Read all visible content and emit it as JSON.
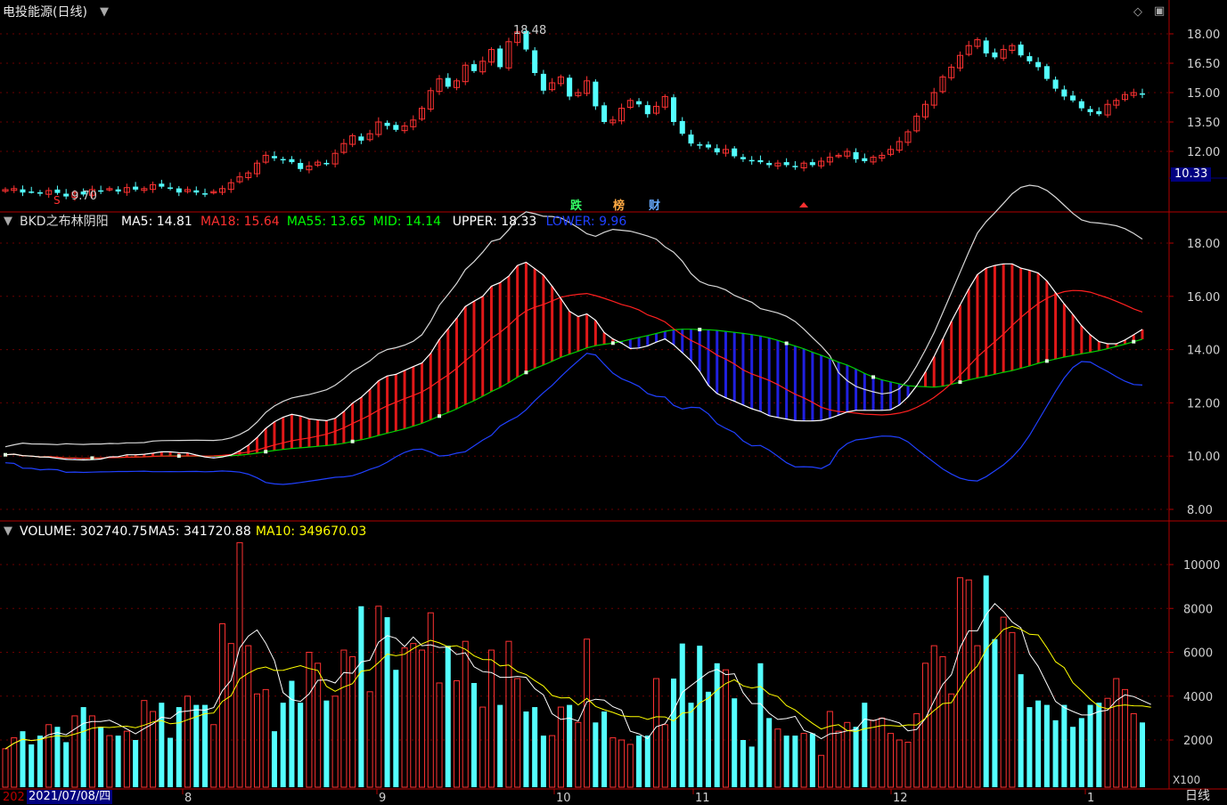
{
  "title": "电投能源(日线)",
  "corner_label": "日线",
  "x_multiplier": "X100",
  "date_labels": {
    "start_year": "202",
    "cursor_date": "2021/07/08/四",
    "months": [
      "8",
      "9",
      "10",
      "11",
      "12",
      "1"
    ]
  },
  "signals": [
    "跌",
    "榜",
    "财"
  ],
  "colors": {
    "up": "#ff3232",
    "down": "#54ffff",
    "axis": "#b00000",
    "ma5": "#ffffff",
    "ma18": "#ff2020",
    "ma55": "#00ff00",
    "lower": "#2020ff",
    "ma10": "#ffff00"
  },
  "panels": {
    "price": {
      "high_label": "18.48",
      "low_label": "9.70",
      "current_price": "10.33",
      "y_ticks": [
        "18.00",
        "16.50",
        "15.00",
        "13.50",
        "12.00"
      ]
    },
    "bkd": {
      "name": "BKD之布林阴阳",
      "legend": [
        {
          "text": "MA5: 14.81",
          "color": "#ffffff"
        },
        {
          "text": "MA18: 15.64",
          "color": "#ff3030"
        },
        {
          "text": "MA55: 13.65",
          "color": "#00ff00"
        },
        {
          "text": "MID: 14.14",
          "color": "#00ff00"
        },
        {
          "text": "UPPER: 18.33",
          "color": "#ffffff"
        },
        {
          "text": "LOWER: 9.96",
          "color": "#2040ff"
        }
      ],
      "y_ticks": [
        "18.00",
        "16.00",
        "14.00",
        "12.00",
        "10.00",
        "8.00"
      ]
    },
    "volume": {
      "legend": [
        {
          "text": "VOLUME: 302740.75",
          "color": "#ffffff"
        },
        {
          "text": "MA5: 341720.88",
          "color": "#ffffff"
        },
        {
          "text": "MA10: 349670.03",
          "color": "#ffff00"
        }
      ],
      "y_ticks": [
        "10000",
        "8000",
        "6000",
        "4000",
        "2000"
      ]
    }
  },
  "chart_data": {
    "type": "candlestick",
    "close": [
      10.05,
      10.1,
      9.9,
      9.95,
      9.85,
      10.0,
      9.88,
      9.7,
      9.9,
      9.8,
      10.05,
      10.0,
      10.1,
      9.95,
      10.15,
      10.05,
      10.1,
      10.3,
      10.2,
      10.15,
      9.9,
      10.05,
      9.9,
      9.85,
      9.95,
      10.1,
      10.4,
      10.7,
      10.9,
      11.4,
      11.8,
      11.65,
      11.55,
      11.45,
      11.1,
      11.25,
      11.45,
      11.4,
      11.9,
      12.4,
      12.8,
      12.55,
      12.9,
      13.5,
      13.3,
      13.1,
      13.3,
      13.6,
      14.2,
      15.1,
      15.7,
      15.3,
      15.6,
      16.4,
      16.1,
      16.6,
      17.2,
      16.3,
      17.6,
      18.1,
      17.2,
      16.0,
      15.1,
      15.5,
      15.8,
      14.8,
      15.0,
      15.6,
      14.3,
      13.5,
      13.6,
      14.2,
      14.6,
      14.4,
      13.9,
      14.3,
      14.8,
      13.5,
      12.9,
      12.4,
      12.3,
      12.2,
      11.95,
      12.1,
      11.75,
      11.6,
      11.5,
      11.45,
      11.3,
      11.4,
      11.3,
      11.2,
      11.4,
      11.3,
      11.5,
      11.7,
      11.8,
      12.0,
      11.6,
      11.5,
      11.7,
      11.8,
      12.1,
      12.5,
      13.0,
      13.8,
      14.4,
      15.0,
      15.8,
      16.3,
      16.9,
      17.4,
      17.7,
      17.0,
      16.8,
      17.2,
      17.4,
      16.9,
      16.6,
      16.3,
      15.7,
      15.2,
      14.8,
      14.6,
      14.2,
      14.0,
      13.9,
      14.4,
      14.6,
      14.9,
      15.0,
      14.9
    ],
    "dates": {
      "start": "2021/07/08",
      "month_ticks": [
        "8",
        "9",
        "10",
        "11",
        "12",
        "1"
      ]
    },
    "price_range": [
      9.7,
      18.48
    ],
    "indicators": {
      "BKD": {
        "MA5": 14.81,
        "MA18": 15.64,
        "MA55": 13.65,
        "MID": 14.14,
        "UPPER": 18.33,
        "LOWER": 9.96
      },
      "VOLUME": {
        "VOLUME": 302740.75,
        "MA5": 341720.88,
        "MA10": 349670.03
      }
    },
    "volume": [
      1600,
      2100,
      2400,
      1800,
      2200,
      2700,
      2600,
      1900,
      3100,
      3500,
      3100,
      2600,
      2200,
      2200,
      2400,
      2000,
      3800,
      3300,
      3700,
      2100,
      3500,
      4000,
      3600,
      3600,
      2700,
      7300,
      6400,
      11000,
      6300,
      4100,
      4300,
      2400,
      3700,
      4700,
      3700,
      6000,
      5500,
      3800,
      4000,
      6100,
      5800,
      8100,
      4200,
      8100,
      7600,
      5200,
      6200,
      6400,
      6100,
      7800,
      4600,
      6300,
      4700,
      6500,
      4600,
      3500,
      6100,
      3600,
      6500,
      4800,
      3300,
      3500,
      2200,
      2200,
      3500,
      3600,
      2800,
      6600,
      2800,
      3300,
      2100,
      2000,
      1800,
      2200,
      2200,
      4800,
      2700,
      4800,
      6400,
      3700,
      6300,
      4200,
      5500,
      5200,
      3900,
      2000,
      1700,
      5500,
      3000,
      2500,
      2200,
      2200,
      2300,
      2300,
      1300,
      3300,
      2400,
      2800,
      2600,
      3700,
      2900,
      3000,
      2300,
      2000,
      1900,
      3200,
      5500,
      6300,
      5800,
      4100,
      9400,
      9300,
      6300,
      9500,
      6600,
      7600,
      6900,
      5000,
      3500,
      3800,
      3600,
      2900,
      3600,
      2600,
      3000,
      3600,
      3700,
      3900,
      4800,
      4300,
      3200,
      2800,
      3000
    ]
  }
}
